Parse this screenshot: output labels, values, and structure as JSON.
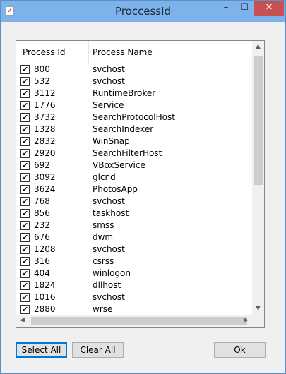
{
  "window": {
    "title": "ProccessId",
    "minimize": "–",
    "maximize": "☐",
    "close": "✕",
    "icon": "checklist-icon"
  },
  "list": {
    "headers": {
      "id": "Process Id",
      "name": "Process Name"
    },
    "rows": [
      {
        "id": "800",
        "name": "svchost"
      },
      {
        "id": "532",
        "name": "svchost"
      },
      {
        "id": "3112",
        "name": "RuntimeBroker"
      },
      {
        "id": "1776",
        "name": "Service"
      },
      {
        "id": "3732",
        "name": "SearchProtocolHost"
      },
      {
        "id": "1328",
        "name": "SearchIndexer"
      },
      {
        "id": "2832",
        "name": "WinSnap"
      },
      {
        "id": "2920",
        "name": "SearchFilterHost"
      },
      {
        "id": "692",
        "name": "VBoxService"
      },
      {
        "id": "3092",
        "name": "glcnd"
      },
      {
        "id": "3624",
        "name": "PhotosApp"
      },
      {
        "id": "768",
        "name": "svchost"
      },
      {
        "id": "856",
        "name": "taskhost"
      },
      {
        "id": "232",
        "name": "smss"
      },
      {
        "id": "676",
        "name": "dwm"
      },
      {
        "id": "1208",
        "name": "svchost"
      },
      {
        "id": "316",
        "name": "csrss"
      },
      {
        "id": "404",
        "name": "winlogon"
      },
      {
        "id": "1824",
        "name": "dllhost"
      },
      {
        "id": "1016",
        "name": "svchost"
      },
      {
        "id": "2880",
        "name": "wrse"
      }
    ],
    "checkmark": "✔"
  },
  "buttons": {
    "select_all": "Select All",
    "clear_all": "Clear All",
    "ok": "Ok"
  }
}
